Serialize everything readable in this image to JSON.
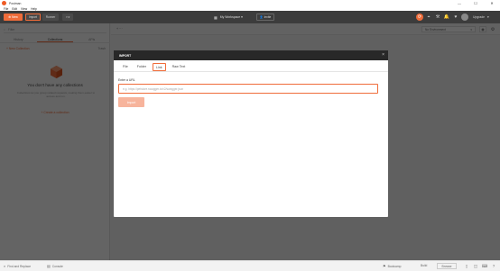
{
  "window": {
    "title": "Postman",
    "minimize": "—",
    "maximize": "☐",
    "close": "✕"
  },
  "menu": [
    "File",
    "Edit",
    "View",
    "Help"
  ],
  "toolbar": {
    "new_label": "New",
    "import_label": "Import",
    "runner_label": "Runner",
    "new_window_label": "▾",
    "workspace_label": "My Workspace",
    "invite_label": "Invite",
    "upgrade_label": "Upgrade",
    "colors": {
      "accent": "#ef6c3a",
      "bar": "#3c3c3c"
    }
  },
  "sidebar": {
    "filter_placeholder": "Filter",
    "tabs": [
      "History",
      "Collections",
      "APIs"
    ],
    "new_collection": "+ New Collection",
    "trash": "Trash",
    "empty_title": "You don't have any collections",
    "empty_desc": "Collections let you group related requests, making them easier to access and run.",
    "create_collection": "+ Create a collection"
  },
  "main": {
    "add_tab": "+ ···",
    "environment": "No Environment"
  },
  "modal": {
    "title": "IMPORT",
    "tabs": [
      "File",
      "Folder",
      "Link",
      "Raw Text"
    ],
    "active_tab": "Link",
    "url_label": "Enter a URL",
    "url_placeholder": "e.g. https://petstore.swagger.io/v2/swagger.json",
    "import_button": "Import"
  },
  "statusbar": {
    "find_replace": "Find and Replace",
    "console": "Console",
    "bootcamp": "Bootcamp",
    "build": "Build",
    "browse": "Browse"
  }
}
